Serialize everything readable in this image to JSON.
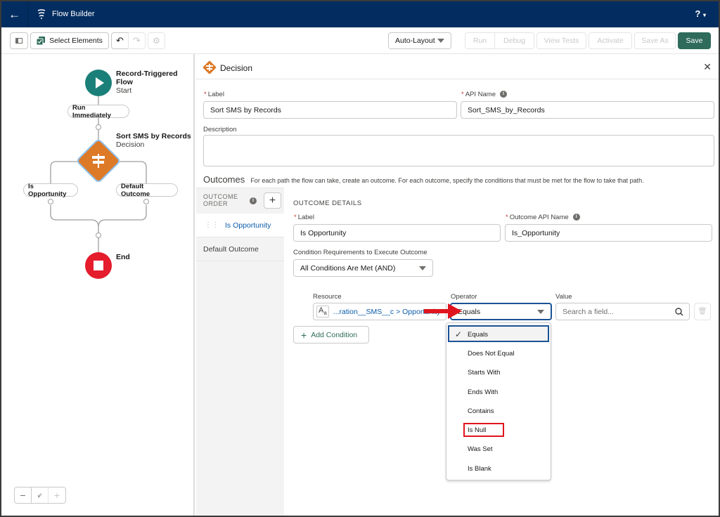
{
  "app": {
    "title": "Flow Builder",
    "help_label": "?"
  },
  "toolbar": {
    "select_elements": "Select Elements",
    "layout_select": "Auto-Layout",
    "run": "Run",
    "debug": "Debug",
    "view_tests": "View Tests",
    "activate": "Activate",
    "save_as": "Save As",
    "save": "Save"
  },
  "canvas": {
    "start": {
      "title": "Record-Triggered Flow",
      "subtitle": "Start"
    },
    "run_immediately": "Run Immediately",
    "decision": {
      "title": "Sort SMS by Records",
      "subtitle": "Decision"
    },
    "branches": [
      "Is Opportunity",
      "Default Outcome"
    ],
    "end": {
      "title": "End"
    },
    "colors": {
      "start": "#1b7f79",
      "decision": "#dd7a27",
      "end": "#e41c2c"
    }
  },
  "panel": {
    "header": "Decision",
    "label_field": {
      "label": "Label",
      "value": "Sort SMS by Records"
    },
    "api_name_field": {
      "label": "API Name",
      "value": "Sort_SMS_by_Records"
    },
    "description_field": {
      "label": "Description",
      "value": ""
    },
    "outcomes": {
      "title": "Outcomes",
      "help_text": "For each path the flow can take, create an outcome. For each outcome, specify the conditions that must be met for the flow to take that path."
    },
    "outcome_order": {
      "header": "OUTCOME ORDER",
      "items": [
        "Is Opportunity",
        "Default Outcome"
      ]
    },
    "outcome_details": {
      "header": "OUTCOME DETAILS",
      "label_field": {
        "label": "Label",
        "value": "Is Opportunity"
      },
      "api_name_field": {
        "label": "Outcome API Name",
        "value": "Is_Opportunity"
      },
      "condition_requirements": {
        "label": "Condition Requirements to Execute Outcome",
        "value": "All Conditions Are Met (AND)"
      },
      "condition": {
        "resource_label": "Resource",
        "resource_value": "...ration__SMS__c > Opportunity",
        "operator_label": "Operator",
        "operator_value": "Equals",
        "value_label": "Value",
        "value_placeholder": "Search a field..."
      },
      "add_condition": "Add Condition",
      "operator_options": [
        "Equals",
        "Does Not Equal",
        "Starts With",
        "Ends With",
        "Contains",
        "Is Null",
        "Was Set",
        "Is Blank"
      ],
      "selected_operator": "Equals",
      "highlighted_option": "Is Null"
    }
  },
  "annotation_color": "#e0141e"
}
